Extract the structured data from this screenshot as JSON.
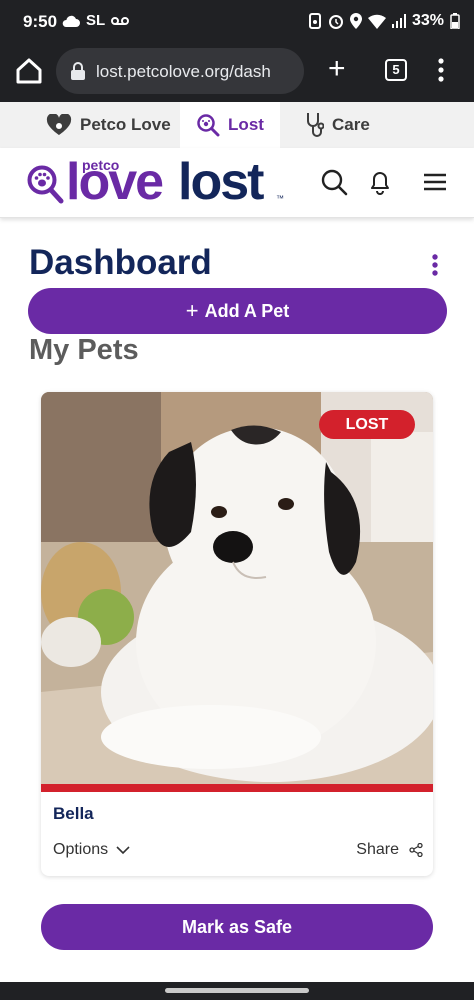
{
  "status_bar": {
    "time": "9:50",
    "carrier": "SL",
    "battery": "33%",
    "icons": [
      "cloud-icon",
      "voicemail-icon",
      "wifi-calling-icon",
      "alarm-icon",
      "location-icon",
      "wifi-icon",
      "signal-icon",
      "battery-icon"
    ]
  },
  "browser": {
    "url": "lost.petcolove.org/dash",
    "tab_count": "5"
  },
  "site_tabs": [
    {
      "label": "Petco Love",
      "icon": "heart-paw-icon",
      "active": false
    },
    {
      "label": "Lost",
      "icon": "search-paw-icon",
      "active": true
    },
    {
      "label": "Care",
      "icon": "stethoscope-icon",
      "active": false
    }
  ],
  "logo": {
    "small": "petco",
    "love": "love",
    "lost": "lost",
    "tm": "™"
  },
  "dashboard": {
    "title": "Dashboard",
    "add_pet_label": "Add A Pet",
    "add_pet_symbol": "+",
    "section_title": "My Pets"
  },
  "pet": {
    "name": "Bella",
    "status": "LOST",
    "options_label": "Options",
    "share_label": "Share"
  },
  "mark_safe_label": "Mark as Safe",
  "colors": {
    "brand_purple": "#6a2aa5",
    "brand_navy": "#13265a",
    "lost_red": "#d3212c",
    "chrome_dark": "#202124"
  }
}
